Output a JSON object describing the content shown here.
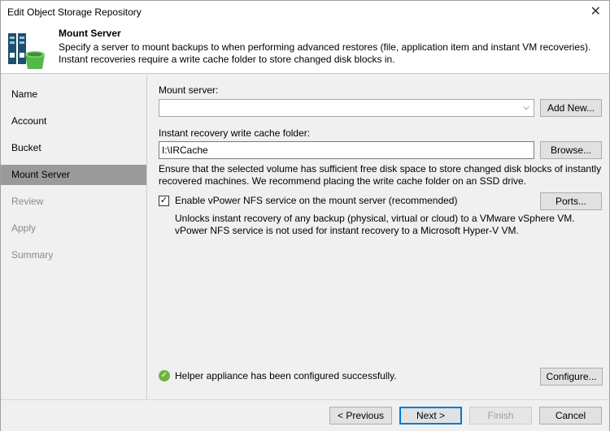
{
  "window": {
    "title": "Edit Object Storage Repository"
  },
  "header": {
    "title": "Mount Server",
    "description": "Specify a server to mount backups to when performing advanced restores (file, application item and instant VM recoveries). Instant recoveries require a write cache folder to store changed disk blocks in.",
    "icon": "object-storage-repository-icon"
  },
  "sidebar": {
    "items": [
      {
        "label": "Name",
        "state": "normal"
      },
      {
        "label": "Account",
        "state": "normal"
      },
      {
        "label": "Bucket",
        "state": "normal"
      },
      {
        "label": "Mount Server",
        "state": "active"
      },
      {
        "label": "Review",
        "state": "disabled"
      },
      {
        "label": "Apply",
        "state": "disabled"
      },
      {
        "label": "Summary",
        "state": "disabled"
      }
    ]
  },
  "main": {
    "mount_server_label": "Mount server:",
    "mount_server_value": "",
    "add_new_label": "Add New...",
    "cache_folder_label": "Instant recovery write cache folder:",
    "cache_folder_value": "I:\\IRCache",
    "browse_label": "Browse...",
    "cache_note": "Ensure that the selected volume has sufficient free disk space to store changed disk blocks of instantly recovered machines. We recommend placing the write cache folder on an SSD drive.",
    "nfs_checkbox_label": "Enable vPower NFS service on the mount server (recommended)",
    "nfs_checked": true,
    "ports_label": "Ports...",
    "nfs_note": "Unlocks instant recovery of any backup (physical, virtual or cloud) to a VMware vSphere VM. vPower NFS service is not used for instant recovery to a Microsoft Hyper-V VM.",
    "status_text": "Helper appliance has been configured successfully.",
    "configure_label": "Configure..."
  },
  "footer": {
    "previous_label": "< Previous",
    "next_label": "Next >",
    "finish_label": "Finish",
    "cancel_label": "Cancel"
  }
}
